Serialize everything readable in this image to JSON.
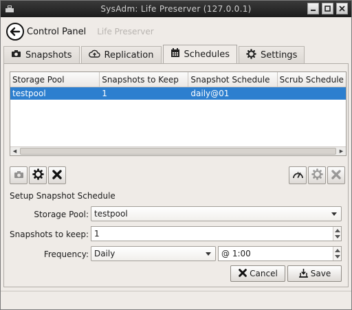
{
  "window": {
    "title": "SysAdm: Life Preserver (127.0.0.1)",
    "controls": {
      "minimize": "minimize-icon",
      "maximize": "maximize-icon",
      "close": "close-icon"
    }
  },
  "nav": {
    "home_label": "Control Panel",
    "current_label": "Life Preserver"
  },
  "tabs": [
    {
      "label": "Snapshots",
      "icon": "camera-icon",
      "active": false
    },
    {
      "label": "Replication",
      "icon": "cloud-upload-icon",
      "active": false
    },
    {
      "label": "Schedules",
      "icon": "calendar-icon",
      "active": true
    },
    {
      "label": "Settings",
      "icon": "gear-icon",
      "active": false
    }
  ],
  "table": {
    "columns": [
      "Storage Pool",
      "Snapshots to Keep",
      "Snapshot Schedule",
      "Scrub Schedule"
    ],
    "rows": [
      {
        "cells": [
          "testpool",
          "1",
          "daily@01",
          ""
        ],
        "selected": true
      }
    ]
  },
  "left_tools": [
    "camera-icon",
    "gear-icon",
    "x-icon"
  ],
  "right_tools": [
    "speedometer-icon",
    "gear-icon",
    "x-icon"
  ],
  "form": {
    "section_title": "Setup Snapshot Schedule",
    "pool_label": "Storage Pool:",
    "pool_value": "testpool",
    "keep_label": "Snapshots to keep:",
    "keep_value": "1",
    "freq_label": "Frequency:",
    "freq_value": "Daily",
    "time_value": "@ 1:00",
    "cancel_label": "Cancel",
    "save_label": "Save"
  },
  "colors": {
    "selection": "#2d7fcf",
    "window_bg": "#efebe7"
  }
}
